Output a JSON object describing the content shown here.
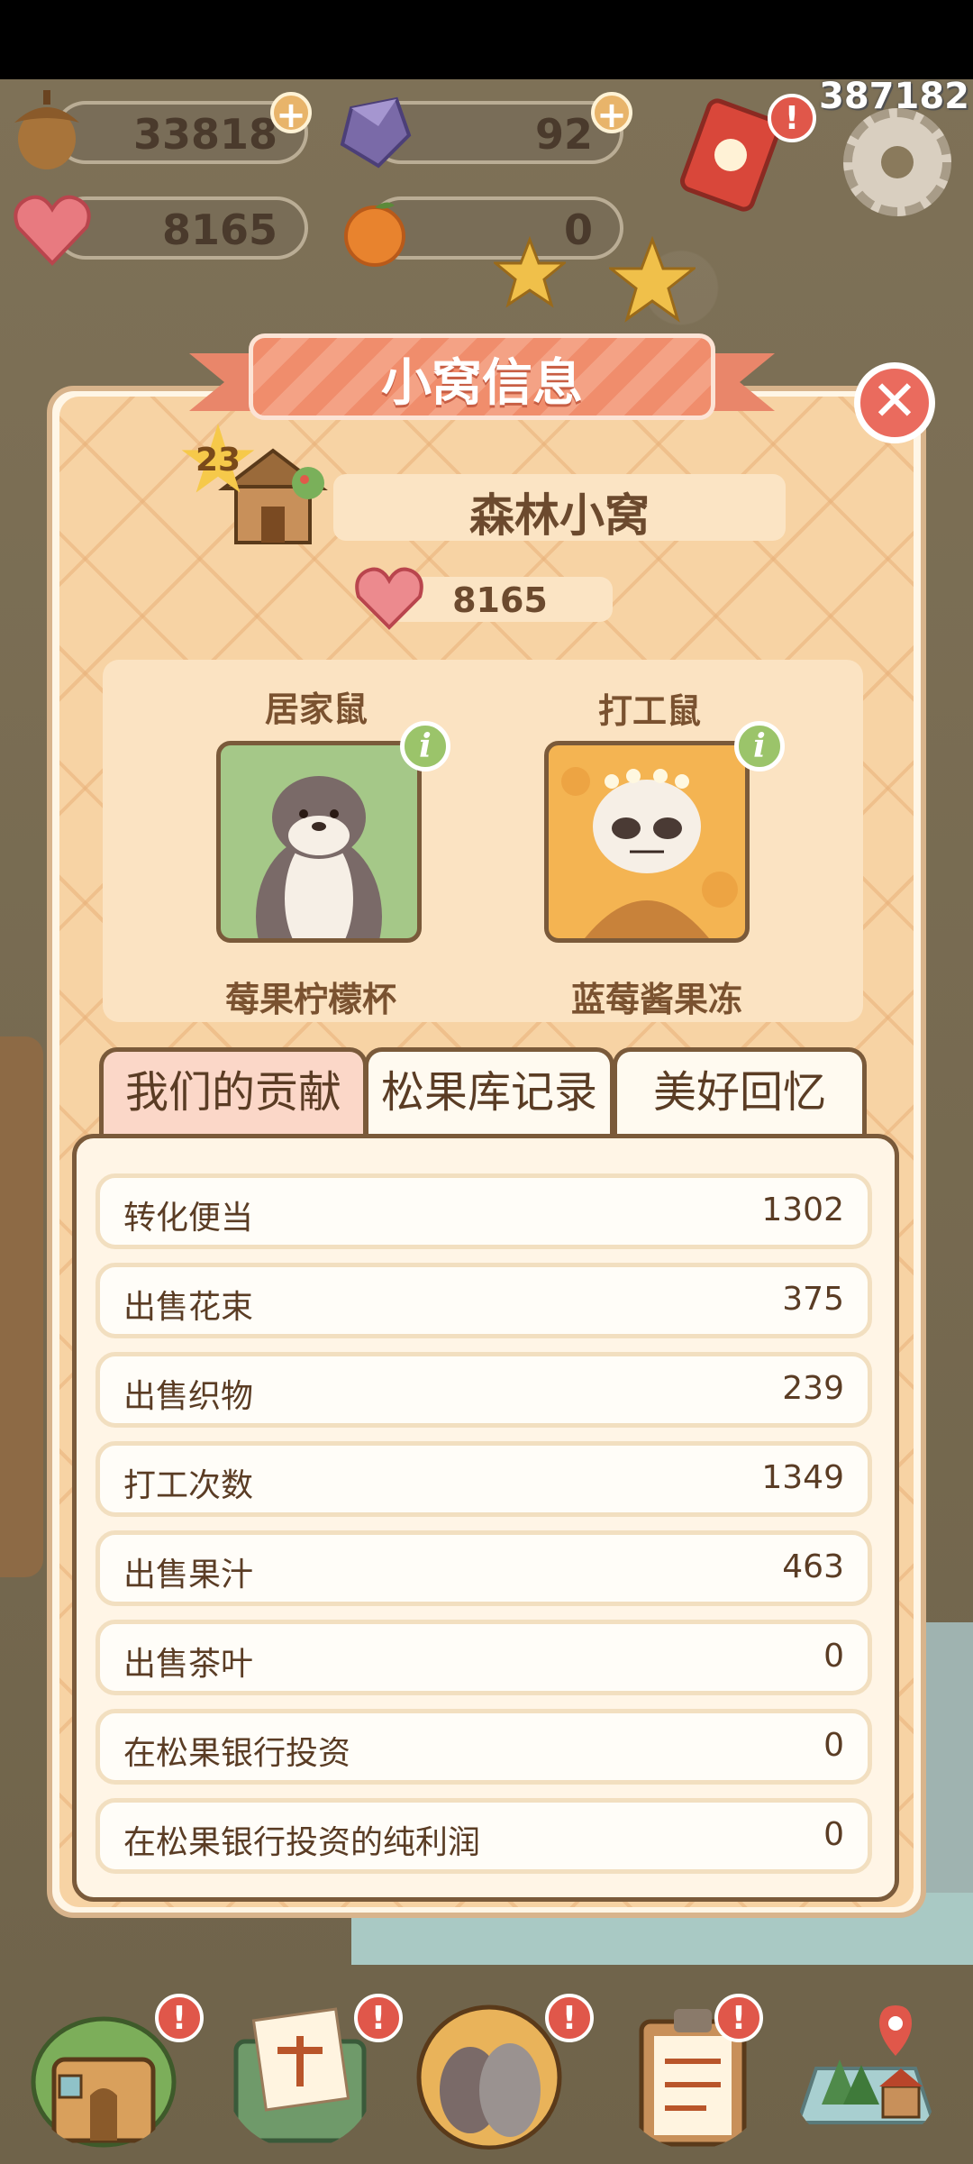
{
  "hud": {
    "corner_number": "387182",
    "acorns": "33818",
    "crystals": "92",
    "hearts": "8165",
    "oranges": "0",
    "plus": "+",
    "alert": "!"
  },
  "dialog": {
    "title": "小窝信息",
    "close": "✕",
    "level": "23",
    "nest_name": "森林小窝",
    "heart_count": "8165",
    "info_glyph": "i"
  },
  "residents": [
    {
      "role": "居家鼠",
      "name": "莓果柠檬杯"
    },
    {
      "role": "打工鼠",
      "name": "蓝莓酱果冻"
    }
  ],
  "tabs": [
    {
      "label": "我们的贡献",
      "active": true
    },
    {
      "label": "松果库记录",
      "active": false
    },
    {
      "label": "美好回忆",
      "active": false
    }
  ],
  "stats": [
    {
      "label": "转化便当",
      "value": "1302"
    },
    {
      "label": "出售花束",
      "value": "375"
    },
    {
      "label": "出售织物",
      "value": "239"
    },
    {
      "label": "打工次数",
      "value": "1349"
    },
    {
      "label": "出售果汁",
      "value": "463"
    },
    {
      "label": "出售茶叶",
      "value": "0"
    },
    {
      "label": "在松果银行投资",
      "value": "0"
    },
    {
      "label": "在松果银行投资的纯利润",
      "value": "0"
    }
  ],
  "bottom_nav": [
    {
      "icon": "house-door-icon"
    },
    {
      "icon": "letter-envelope-icon"
    },
    {
      "icon": "pets-portrait-icon"
    },
    {
      "icon": "clipboard-task-icon"
    },
    {
      "icon": "map-icon"
    }
  ]
}
